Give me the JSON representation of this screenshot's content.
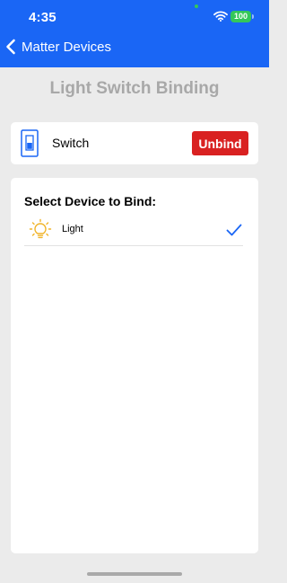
{
  "status_bar": {
    "time": "4:35",
    "battery": "100",
    "icons": [
      "wifi-icon",
      "battery-icon"
    ]
  },
  "nav": {
    "back_label": "Matter Devices",
    "back_icon": "chevron-left-icon",
    "color": "#1a66f5"
  },
  "page": {
    "title": "Light Switch Binding"
  },
  "binding": {
    "device_label": "Switch",
    "device_icon": "light-switch-icon",
    "unbind_label": "Unbind",
    "unbind_color": "#d92121"
  },
  "select": {
    "heading": "Select Device to Bind:",
    "devices": [
      {
        "label": "Light",
        "icon": "lightbulb-icon",
        "selected": true,
        "selected_icon": "checkmark-icon"
      }
    ]
  }
}
